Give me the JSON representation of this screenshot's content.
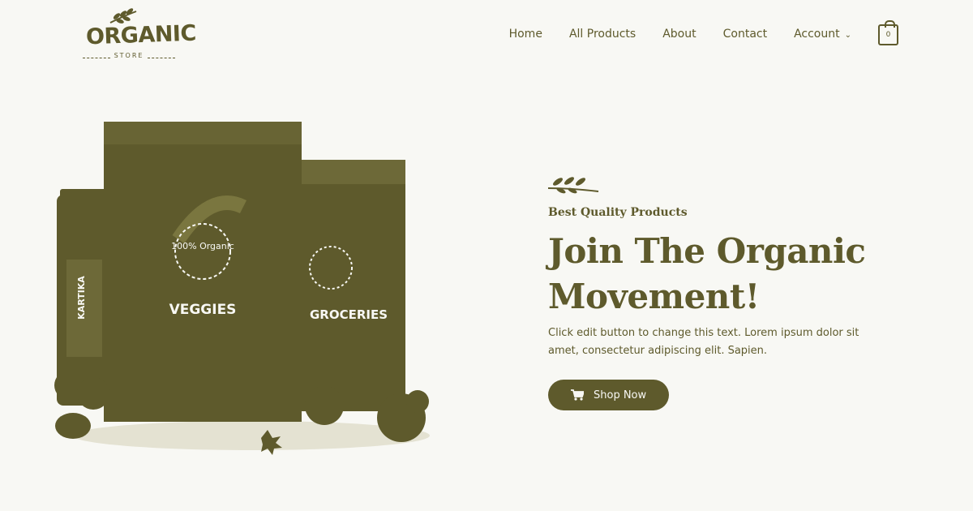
{
  "brand": {
    "logo_text": "ORGANIC",
    "logo_sub": "STORE"
  },
  "nav": {
    "items": [
      {
        "label": "Home"
      },
      {
        "label": "All Products"
      },
      {
        "label": "About"
      },
      {
        "label": "Contact"
      },
      {
        "label": "Account"
      }
    ],
    "cart_count": "0"
  },
  "hero": {
    "tagline": "Best Quality Products",
    "headline": "Join The Organic Movement!",
    "body": "Click edit button to change this text. Lorem ipsum dolor sit amet, consectetur adipiscing elit. Sapien.",
    "button_label": "Shop Now",
    "products": {
      "jar_label": "KARTIKA",
      "bag_badge": "100% Organic",
      "bag_front": "VEGGIES",
      "bag_back": "GROCERIES"
    }
  },
  "colors": {
    "primary": "#5e5a2c",
    "background": "#f8f8f4"
  },
  "icons": [
    "leaf-sprig-icon",
    "shopping-bag-icon",
    "chevron-down-icon",
    "cart-icon"
  ]
}
